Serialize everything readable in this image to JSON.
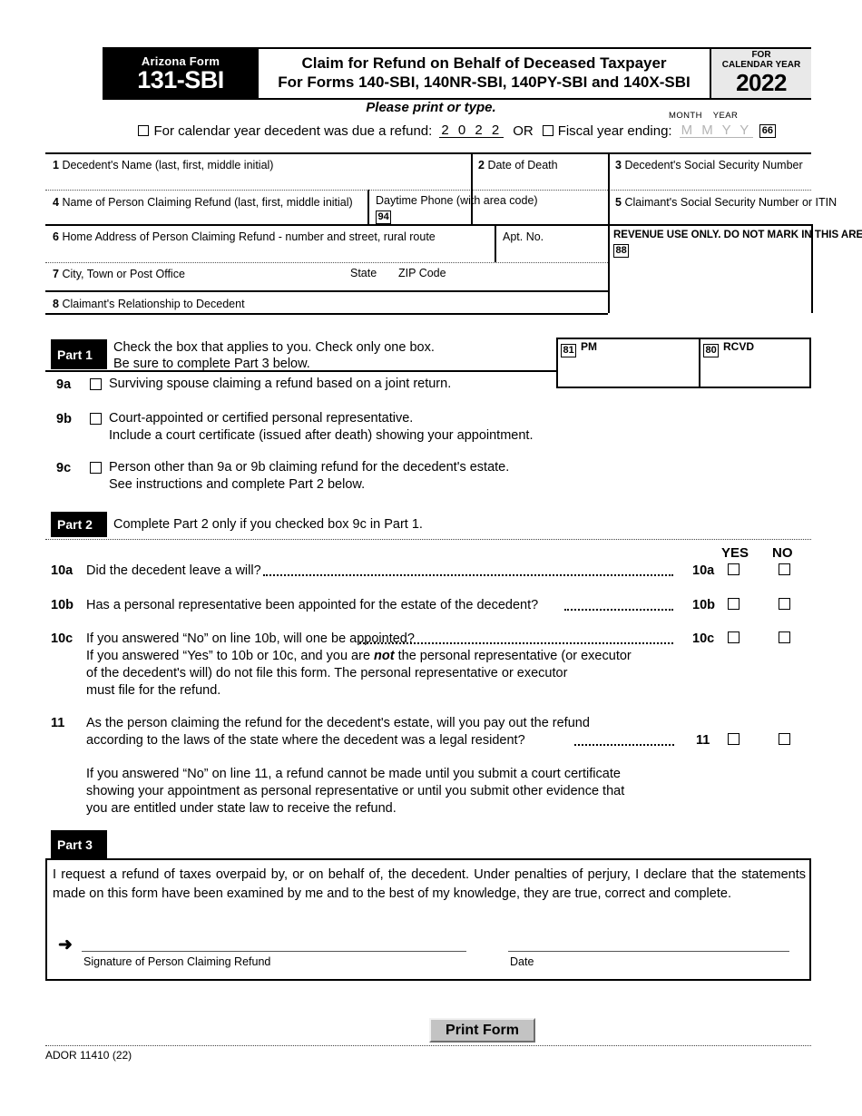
{
  "header": {
    "agency_label": "Arizona Form",
    "form_number": "131-SBI",
    "title_line1": "Claim for Refund on Behalf of Deceased Taxpayer",
    "title_line2": "For Forms 140-SBI, 140NR-SBI, 140PY-SBI and 140X-SBI",
    "cy_label_line1": "FOR",
    "cy_label_line2": "CALENDAR YEAR",
    "cy_year": "2022"
  },
  "instruction": {
    "please_print": "Please print or type."
  },
  "yearline": {
    "calendar_label": "For calendar year decedent was due a refund:",
    "calendar_value": "2 0 2 2",
    "or_label": "OR",
    "fiscal_label": "Fiscal year ending:",
    "fiscal_placeholder": "M M Y Y",
    "month_label": "MONTH",
    "year_label": "YEAR",
    "code_66": "66"
  },
  "identification": {
    "field1_num": "1",
    "field1_label": "Decedent's Name (last, first, middle initial)",
    "field2_num": "2",
    "field2_label": "Date of Death",
    "field3_num": "3",
    "field3_label": "Decedent's Social Security Number",
    "field4_num": "4",
    "field4_label": "Name of Person Claiming Refund (last, first, middle initial)",
    "phone_label": "Daytime Phone (with area code)",
    "code_94": "94",
    "field5_num": "5",
    "field5_label": "Claimant's Social Security Number or ITIN",
    "field6_num": "6",
    "field6_label": "Home Address of Person Claiming Refund - number and street, rural route",
    "apt_label": "Apt. No.",
    "revenue_use_label": "REVENUE USE ONLY. DO NOT MARK IN THIS AREA.",
    "code_88": "88",
    "field7_num": "7",
    "field7_label": "City, Town or Post Office",
    "state_label": "State",
    "zip_label": "ZIP Code",
    "field8_num": "8",
    "field8_label": "Claimant's Relationship to Decedent"
  },
  "revenue_boxes": {
    "code_81": "81",
    "pm_label": "PM",
    "code_80": "80",
    "rcvd_label": "RCVD"
  },
  "part1": {
    "bar_label": "Part 1",
    "instruction_line1": "Check the box that applies to you.  Check only one box.",
    "instruction_line2": "Be sure to complete Part 3 below.",
    "items": [
      {
        "num": "9a",
        "line1": "Surviving spouse claiming a refund based on a joint return.",
        "line2": ""
      },
      {
        "num": "9b",
        "line1": "Court-appointed or certified personal representative.",
        "line2": "Include a court certificate (issued after death) showing your appointment."
      },
      {
        "num": "9c",
        "line1": "Person other than 9a or 9b claiming refund for the decedent's estate.",
        "line2": "See instructions and complete Part 2 below."
      }
    ]
  },
  "part2": {
    "bar_label": "Part 2",
    "instruction": "Complete Part 2 only if you checked box 9c in Part 1.",
    "yes_header": "YES",
    "no_header": "NO",
    "q10a_num": "10a",
    "q10a_text": "Did the decedent leave a will?",
    "q10a_ref": "10a",
    "q10b_num": "10b",
    "q10b_text": "Has a personal representative been appointed for the estate of the decedent?",
    "q10b_ref": "10b",
    "q10c_num": "10c",
    "q10c_text": "If you answered “No” on line 10b, will one be appointed?",
    "q10c_ref": "10c",
    "q10c_note_a": "If you answered “Yes” to 10b or 10c, and you are ",
    "q10c_note_italic": "not",
    "q10c_note_b": " the personal representative (or executor",
    "q10c_note_line2": "of the decedent's will) do not file this form.  The personal representative or executor",
    "q10c_note_line3": "must file for the refund.",
    "q11_num": "11",
    "q11_line1": "As the person claiming the refund for the decedent's estate, will you pay out the refund",
    "q11_line2": "according to the laws of the state where the decedent was a legal resident?",
    "q11_ref": "11",
    "q11_note_line1": "If you answered “No” on line 11, a refund cannot be made until you submit a court certificate",
    "q11_note_line2": "showing your appointment as personal representative or until you submit other evidence that",
    "q11_note_line3": "you are entitled under state law to receive the refund."
  },
  "part3": {
    "bar_label": "Part 3",
    "declaration_line1": "I request a refund of taxes overpaid by, or on behalf of, the decedent.  Under penalties of perjury, I declare that the statements",
    "declaration_line2": "made on this form have been examined by me and to the best of my knowledge, they are true, correct and complete.",
    "arrow_glyph": "➜",
    "signature_label": "Signature of Person Claiming Refund",
    "date_label": "Date"
  },
  "footer": {
    "print_button": "Print Form",
    "ador": "ADOR 11410 (22)"
  }
}
